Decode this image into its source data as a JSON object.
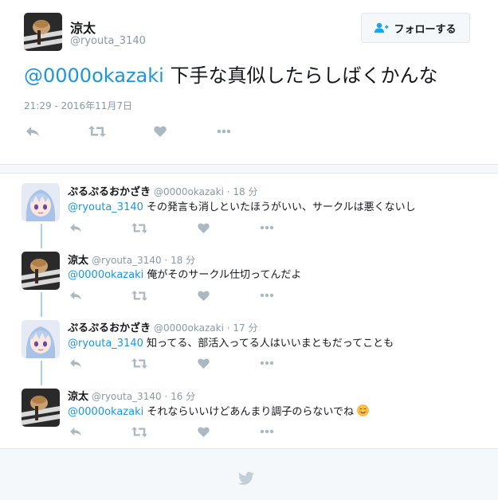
{
  "main_tweet": {
    "author_name": "涼太",
    "author_handle": "@ryouta_3140",
    "follow_label": "フォローする",
    "mention": "@0000okazaki",
    "text": " 下手な真似したらしばくかんな",
    "timestamp": "21:29 - 2016年11月7日"
  },
  "replies": [
    {
      "name": "ぷるぷるおかざき",
      "handle": "@0000okazaki",
      "time": "18 分",
      "mention": "@ryouta_3140",
      "text": " その発言も消しといたほうがいい、サークルは悪くないし"
    },
    {
      "name": "涼太",
      "handle": "@ryouta_3140",
      "time": "18 分",
      "mention": "@0000okazaki",
      "text": " 俺がそのサークル仕切ってんだよ"
    },
    {
      "name": "ぷるぷるおかざき",
      "handle": "@0000okazaki",
      "time": "17 分",
      "mention": "@ryouta_3140",
      "text": " 知ってる、部活入ってる人はいいまともだってことも"
    },
    {
      "name": "涼太",
      "handle": "@ryouta_3140",
      "time": "16 分",
      "mention": "@0000okazaki",
      "text": " それならいいけどあんまり調子のらないでね"
    }
  ],
  "separator": " · ",
  "colors": {
    "link": "#1b95e0",
    "muted": "#8899a6",
    "thread_line": "#a5d1ec",
    "icon": "#aab8c2"
  },
  "icons": [
    "reply-icon",
    "retweet-icon",
    "like-icon",
    "more-icon",
    "follow-person-icon",
    "twitter-bird-icon",
    "smiling-face-emoji"
  ]
}
